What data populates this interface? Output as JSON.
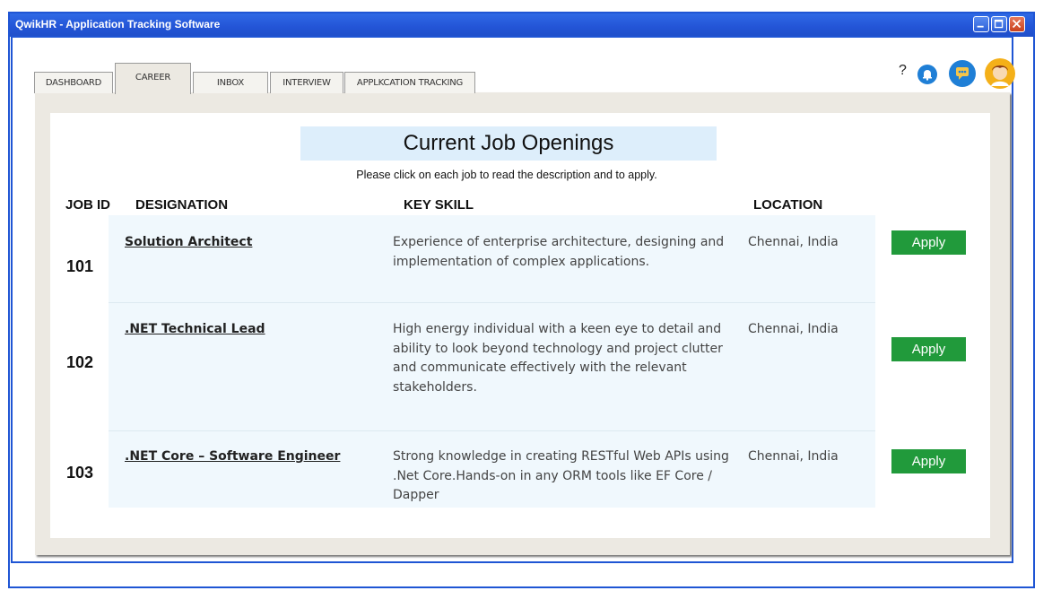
{
  "window": {
    "title": "QwikHR - Application Tracking Software"
  },
  "tabs": [
    {
      "label": "DASHBOARD",
      "active": false
    },
    {
      "label": "CAREER",
      "active": true
    },
    {
      "label": "INBOX",
      "active": false
    },
    {
      "label": "INTERVIEW",
      "active": false
    },
    {
      "label": "APPLKCATION TRACKING",
      "active": false
    }
  ],
  "header": {
    "help": "?"
  },
  "page": {
    "title": "Current Job Openings",
    "subtitle": "Please click on each job to read the description and to apply."
  },
  "columns": {
    "job_id": "JOB ID",
    "designation": "DESIGNATION",
    "key_skill": "KEY SKILL",
    "location": "LOCATION"
  },
  "jobs": [
    {
      "id": "101",
      "designation": "Solution Architect",
      "skill": "Experience of enterprise architecture, designing and implementation of complex applications.",
      "location": "Chennai, India",
      "apply": "Apply"
    },
    {
      "id": "102",
      "designation": ".NET Technical Lead",
      "skill": "High energy individual with a keen eye to detail and ability to look beyond technology and project clutter and communicate effectively with the relevant stakeholders.",
      "location": "Chennai, India",
      "apply": "Apply"
    },
    {
      "id": "103",
      "designation": ".NET Core – Software Engineer",
      "skill": "Strong knowledge in creating RESTful Web APIs using .Net Core.Hands-on in any ORM tools like EF Core / Dapper",
      "location": "Chennai, India",
      "apply": "Apply"
    }
  ],
  "colors": {
    "accent": "#1f55d4",
    "apply_button": "#219a3b",
    "heading_bg": "#ddeefb",
    "row_bg": "#f0f8fd"
  }
}
